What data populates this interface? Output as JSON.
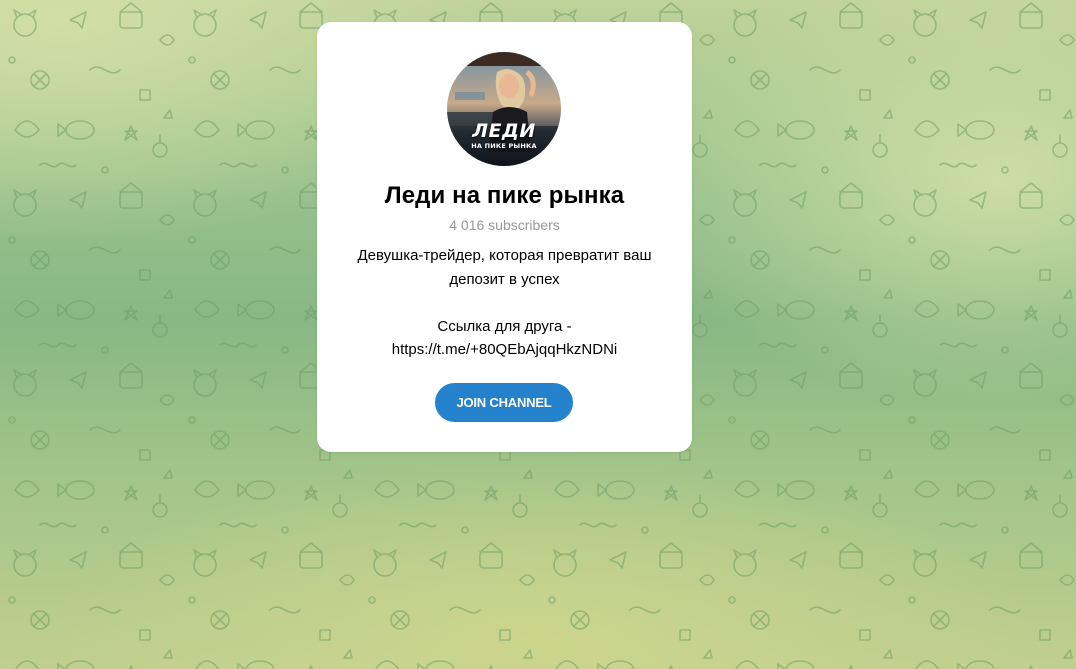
{
  "channel": {
    "title": "Леди на пике рынка",
    "subscribers": "4 016 subscribers",
    "description_lines": [
      "Девушка-трейдер, которая превратит ваш",
      "депозит в успех",
      "",
      "Ссылка для друга -",
      "https://t.me/+80QEbAjqqHkzNDNi"
    ],
    "avatar": {
      "text_big": "ЛЕДИ",
      "text_small": "НА ПИКЕ РЫНКА"
    }
  },
  "join_button": {
    "label": "JOIN CHANNEL",
    "color": "#2481cc"
  },
  "background": {
    "pattern": "doodle-pattern",
    "colors": [
      "#bfd39a",
      "#88b884",
      "#c1cf8f"
    ]
  }
}
